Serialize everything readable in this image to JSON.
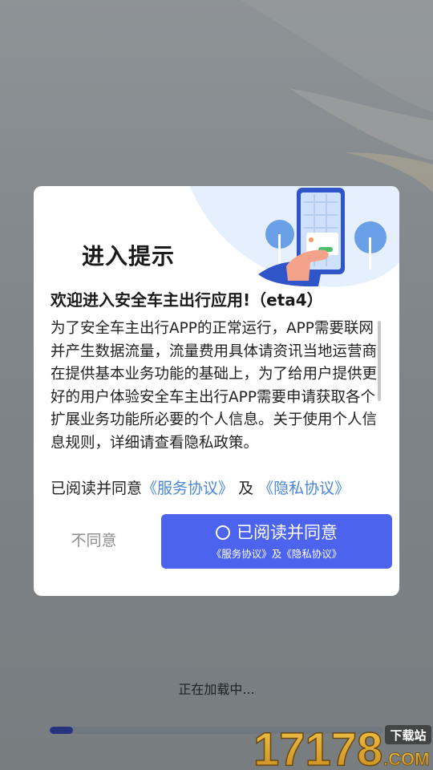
{
  "dialog": {
    "title": "进入提示",
    "welcome": "欢迎进入安全车主出行应用!（eta4）",
    "body": "为了安全车主出行APP的正常运行，APP需要联网并产生数据流量，流量费用具体请资讯当地运营商在提供基本业务功能的基础上，为了给用户提供更好的用户体验安全车主出行APP需要申请获取各个扩展业务功能所必要的个人信息。关于使用个人信息规则，详细请查看隐私政策。",
    "agree_prefix": "已阅读并同意",
    "service_link": "《服务协议》",
    "and_text": "及",
    "privacy_link": "《隐私协议》",
    "disagree_label": "不同意",
    "agree_label": "已阅读并同意",
    "agree_sub": "《服务协议》及《隐私协议》"
  },
  "loading": {
    "text": "正在加载中...",
    "progress": 0.07
  },
  "watermark": {
    "brand": "17178",
    "tag": "下载站",
    "domain": ".COM"
  },
  "colors": {
    "primary": "#4c63ee",
    "link": "#4a86d8",
    "progress_fill": "#27337f",
    "progress_track": "#6f7780"
  }
}
